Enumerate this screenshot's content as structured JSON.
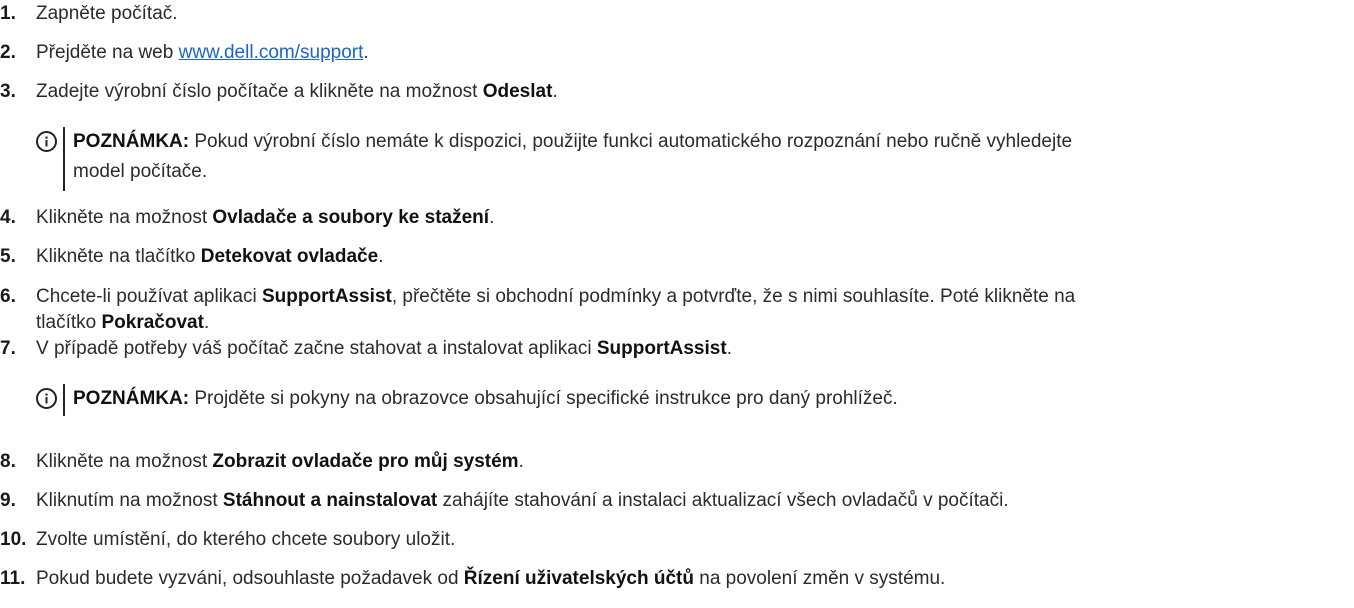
{
  "steps": [
    {
      "num": "1.",
      "parts": [
        {
          "t": "Zapněte počítač."
        }
      ]
    },
    {
      "num": "2.",
      "parts": [
        {
          "t": "Přejděte na web "
        },
        {
          "t": "www.dell.com/support",
          "link": true
        },
        {
          "t": "."
        }
      ]
    },
    {
      "num": "3.",
      "parts": [
        {
          "t": "Zadejte výrobní číslo počítače a klikněte na možnost "
        },
        {
          "t": "Odeslat",
          "b": true
        },
        {
          "t": "."
        }
      ]
    },
    {
      "num": "4.",
      "parts": [
        {
          "t": "Klikněte na možnost "
        },
        {
          "t": "Ovladače a soubory ke stažení",
          "b": true
        },
        {
          "t": "."
        }
      ]
    },
    {
      "num": "5.",
      "parts": [
        {
          "t": "Klikněte na tlačítko "
        },
        {
          "t": "Detekovat ovladače",
          "b": true
        },
        {
          "t": "."
        }
      ]
    },
    {
      "num": "6.",
      "parts": [
        {
          "t": "Chcete-li používat aplikaci "
        },
        {
          "t": "SupportAssist",
          "b": true
        },
        {
          "t": ", přečtěte si obchodní podmínky a potvrďte, že s nimi souhlasíte. Poté klikněte na"
        }
      ],
      "line2": [
        {
          "t": "tlačítko "
        },
        {
          "t": "Pokračovat",
          "b": true
        },
        {
          "t": "."
        }
      ]
    },
    {
      "num": "7.",
      "parts": [
        {
          "t": "V případě potřeby váš počítač začne stahovat a instalovat aplikaci "
        },
        {
          "t": "SupportAssist",
          "b": true
        },
        {
          "t": "."
        }
      ]
    },
    {
      "num": "8.",
      "parts": [
        {
          "t": "Klikněte na možnost "
        },
        {
          "t": "Zobrazit ovladače pro můj systém",
          "b": true
        },
        {
          "t": "."
        }
      ]
    },
    {
      "num": "9.",
      "parts": [
        {
          "t": "Kliknutím na možnost "
        },
        {
          "t": "Stáhnout a nainstalovat",
          "b": true
        },
        {
          "t": " zahájíte stahování a instalaci aktualizací všech ovladačů v počítači."
        }
      ]
    },
    {
      "num": "10.",
      "parts": [
        {
          "t": "Zvolte umístění, do kterého chcete soubory uložit."
        }
      ]
    },
    {
      "num": "11.",
      "parts": [
        {
          "t": "Pokud budete vyzváni, odsouhlaste požadavek od "
        },
        {
          "t": "Řízení uživatelských účtů",
          "b": true
        },
        {
          "t": " na povolení změn v systému."
        }
      ]
    }
  ],
  "notes": [
    {
      "label": "POZNÁMKA:",
      "line1": " Pokud výrobní číslo nemáte k dispozici, použijte funkci automatického rozpoznání nebo ručně vyhledejte",
      "line2": "model počítače."
    },
    {
      "label": "POZNÁMKA:",
      "line1": " Projděte si pokyny na obrazovce obsahující specifické instrukce pro daný prohlížeč."
    }
  ]
}
